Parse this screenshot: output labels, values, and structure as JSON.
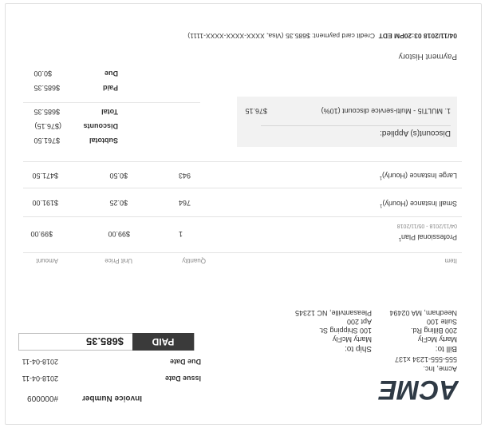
{
  "company": {
    "logo_text": "ACME",
    "name": "Acme, Inc.",
    "phone": "555-555-1234 x137"
  },
  "invoice_meta": {
    "number_label": "Invoice Number",
    "number_value": "#000009",
    "issue_label": "Issue Date",
    "issue_value": "2018-04-11",
    "due_label": "Due Date",
    "due_value": "2018-04-11"
  },
  "bill_to": {
    "heading": "Bill to:",
    "name": "Marty McFly",
    "line1": "200 Billing Rd.",
    "line2": "Suite 100",
    "line3": "Needham, MA 02494"
  },
  "ship_to": {
    "heading": "Ship to:",
    "name": "Marty McFly",
    "line1": "100 Shipping St.",
    "line2": "Apt 200",
    "line3": "Pleasantville, NC 12345"
  },
  "status": {
    "paid_label": "PAID",
    "amount": "$685.35"
  },
  "table": {
    "headers": {
      "item": "Item",
      "quantity": "Quantity",
      "unit_price": "Unit Price",
      "amount": "Amount"
    },
    "rows": [
      {
        "item": "Professional Plan",
        "sup": "1",
        "sub": "04/11/2018 - 05/11/2018",
        "quantity": "1",
        "unit_price": "$99.00",
        "amount": "$99.00"
      },
      {
        "item": "Small Instance (Hourly)",
        "sup": "1",
        "sub": "",
        "quantity": "764",
        "unit_price": "$0.25",
        "amount": "$191.00"
      },
      {
        "item": "Large Instance (Hourly)",
        "sup": "1",
        "sub": "",
        "quantity": "943",
        "unit_price": "$0.50",
        "amount": "$471.50"
      }
    ]
  },
  "discounts": {
    "heading": "Discount(s) Applied:",
    "items": [
      {
        "label": "1. MULTI5 - Multi-service discount (10%)",
        "amount": "$76.15"
      }
    ]
  },
  "totals": {
    "subtotal_label": "Subtotal",
    "subtotal_value": "$761.50",
    "discounts_label": "Discounts",
    "discounts_value": "($76.15)",
    "total_label": "Total",
    "total_value": "$685.35",
    "paid_label": "Paid",
    "paid_value": "$685.35",
    "due_label": "Due",
    "due_value": "$0.00"
  },
  "payment_history": {
    "heading": "Payment History",
    "entries": [
      {
        "timestamp": "04/11/2018 03:20PM EDT",
        "description": "Credit card payment: $685.35 (Visa, XXXX-XXXX-XXXX-1111)"
      }
    ]
  }
}
